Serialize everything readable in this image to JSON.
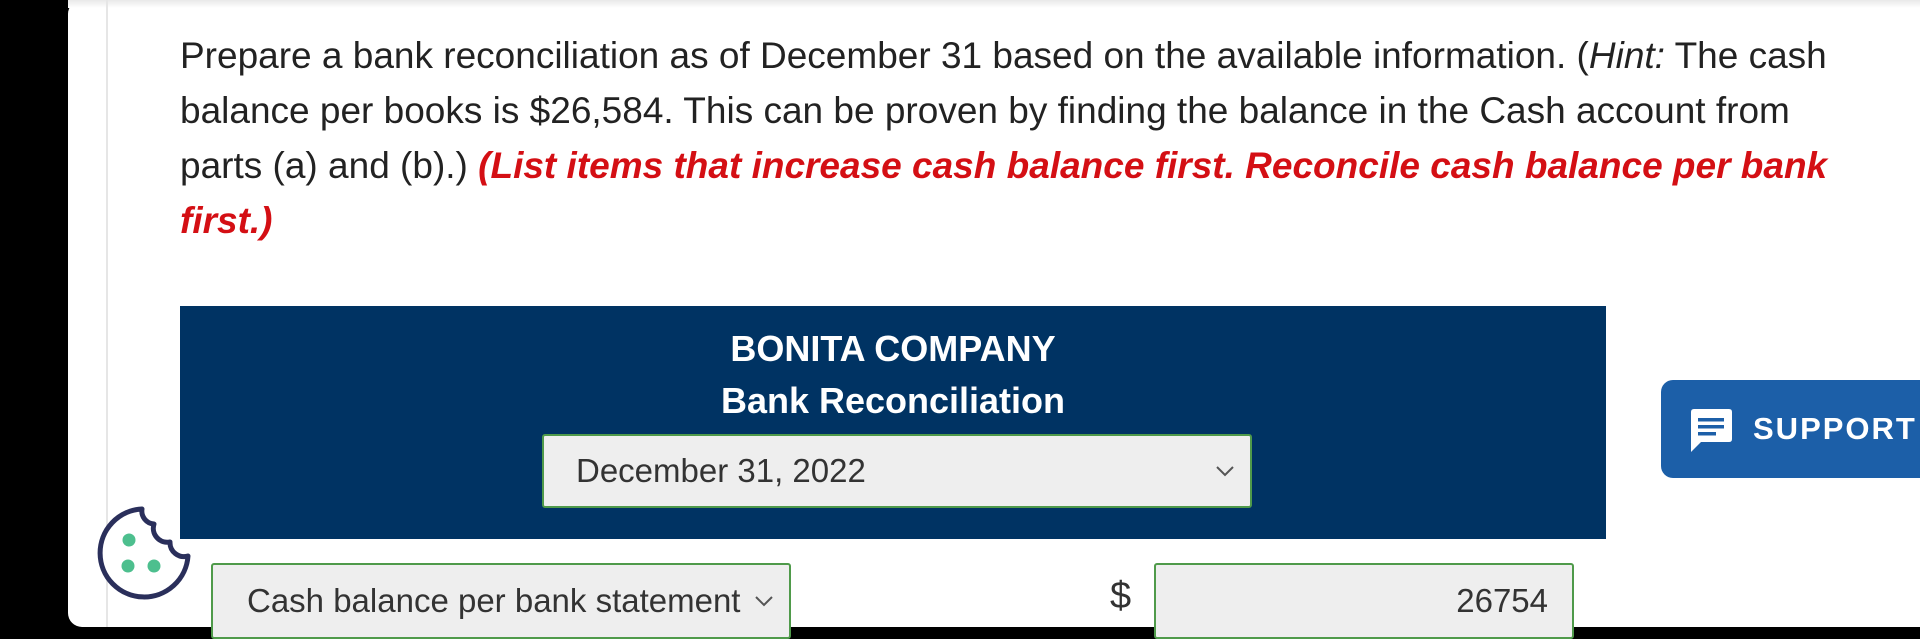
{
  "question": {
    "text_part1": "Prepare a bank reconciliation as of December 31 based on the available information. (",
    "hint_label": "Hint:",
    "text_part2": " The cash balance per books is $26,584. This can be proven by finding the balance in the Cash account from parts (a) and (b).) ",
    "instruction": "(List items that increase cash balance first. Reconcile cash balance per bank first.)"
  },
  "header": {
    "company": "BONITA COMPANY",
    "title": "Bank Reconciliation",
    "date_selected": "December 31, 2022"
  },
  "support": {
    "label": "SUPPORT"
  },
  "rows": [
    {
      "item_selected": "Cash balance per bank statement",
      "currency": "$",
      "amount": "26754"
    }
  ],
  "colors": {
    "header_bg": "#003363",
    "instruction_red": "#d40f14",
    "support_blue": "#1c5fa8",
    "field_border_green": "#4f9a4a",
    "cookie_navy": "#2a2f5b",
    "cookie_dots": "#4dbf8e"
  },
  "icons": {
    "support": "chat-bubble-icon",
    "cookie": "cookie-icon",
    "dropdown": "chevron-down-icon"
  }
}
